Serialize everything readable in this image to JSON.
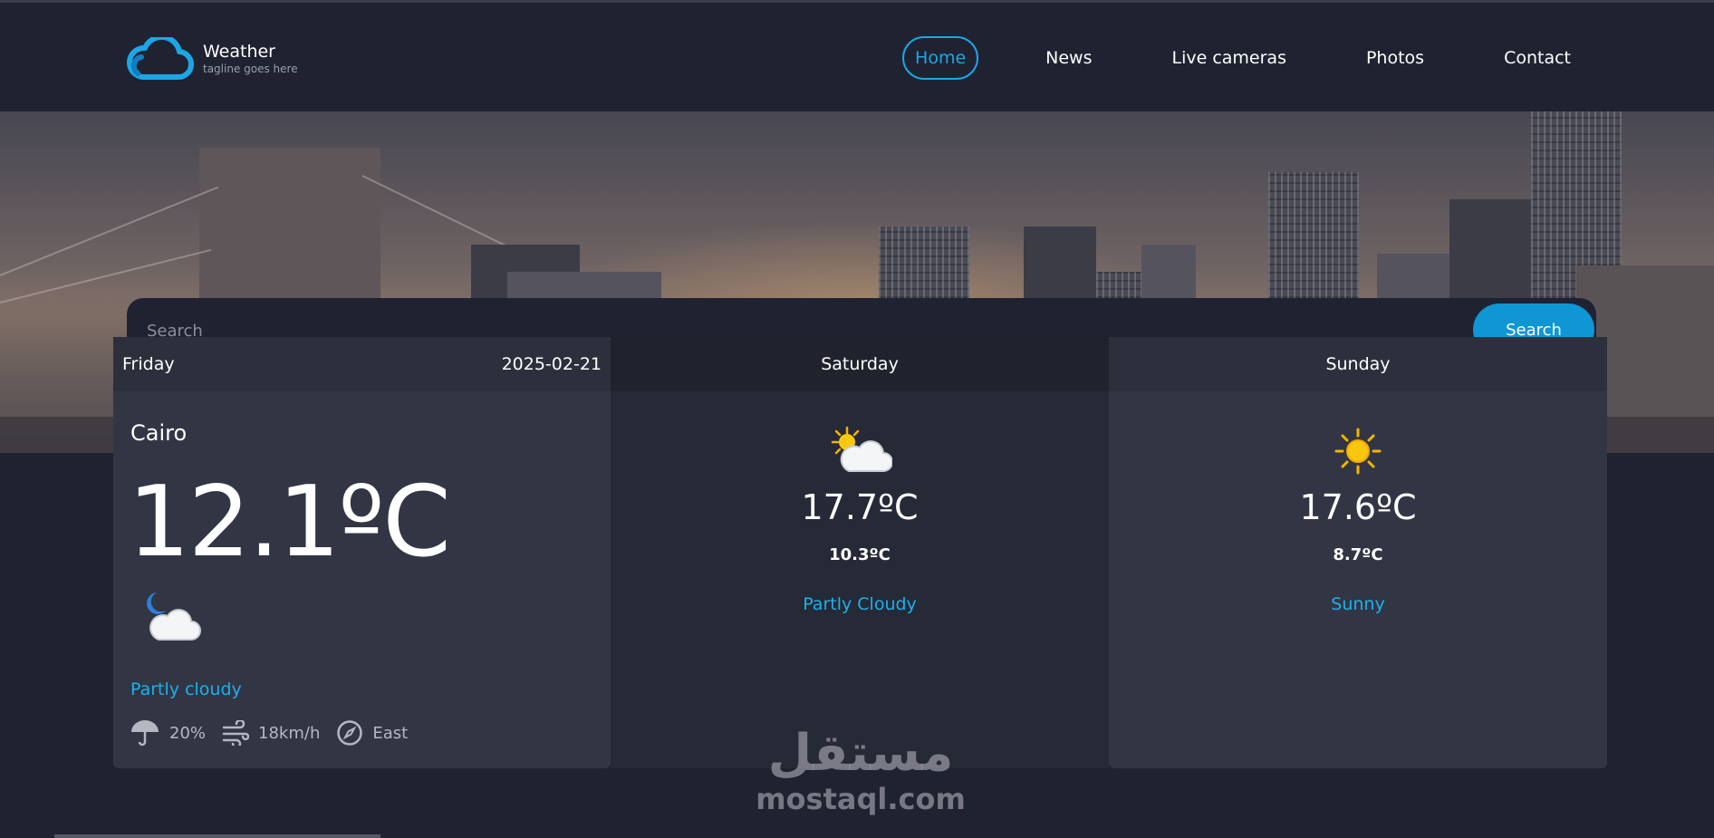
{
  "header": {
    "brand_title": "Weather",
    "brand_tagline": "tagline goes here",
    "nav": [
      {
        "label": "Home",
        "active": true
      },
      {
        "label": "News",
        "active": false
      },
      {
        "label": "Live cameras",
        "active": false
      },
      {
        "label": "Photos",
        "active": false
      },
      {
        "label": "Contact",
        "active": false
      }
    ]
  },
  "search": {
    "placeholder": "Search",
    "value": "",
    "button_label": "Search"
  },
  "today": {
    "day": "Friday",
    "date": "2025-02-21",
    "city": "Cairo",
    "temperature": "12.1ºC",
    "icon": "moon-cloud-icon",
    "condition": "Partly cloudy",
    "precipitation": "20%",
    "wind_speed": "18km/h",
    "wind_direction": "East"
  },
  "forecast": [
    {
      "day": "Saturday",
      "icon": "sun-cloud-icon",
      "max": "17.7ºC",
      "min": "10.3ºC",
      "condition": "Partly Cloudy"
    },
    {
      "day": "Sunday",
      "icon": "sun-icon",
      "max": "17.6ºC",
      "min": "8.7ºC",
      "condition": "Sunny"
    }
  ],
  "watermark": {
    "arabic": "مستقل",
    "latin": "mostaql.com"
  },
  "colors": {
    "accent": "#1ca6e6",
    "background": "#1f2230",
    "card": "#323644",
    "card_alt": "#262936"
  }
}
